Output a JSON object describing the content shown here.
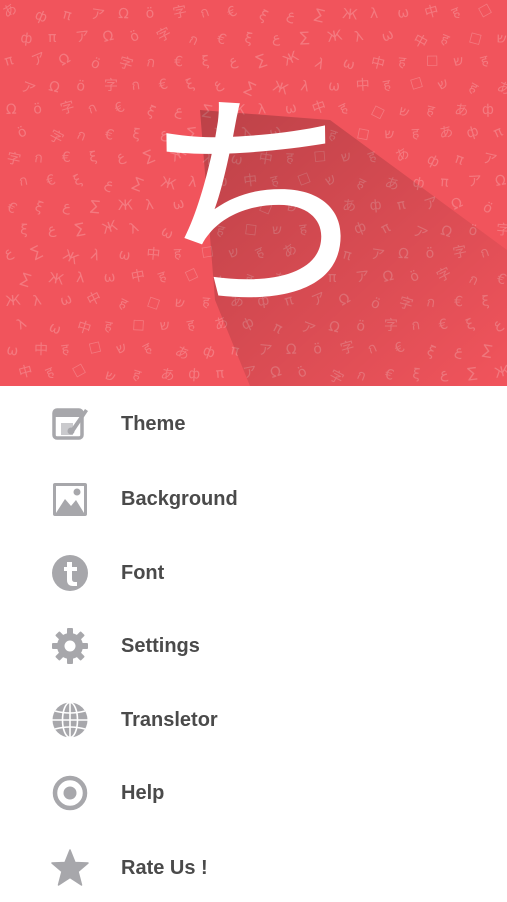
{
  "header": {
    "glyph": "ち",
    "background_color": "#f1545c",
    "glyph_color": "#ffffff",
    "pattern_glyphs": [
      "あ",
      "ア",
      "字",
      "ξ",
      "Ж",
      "中",
      "ש",
      "ф",
      "Ω",
      "ก",
      "ع",
      "λ",
      "ह",
      "ह",
      "π",
      "ö",
      "€",
      "∑",
      "ω",
      "☐"
    ]
  },
  "menu": {
    "icon_color": "#a7a7ab",
    "text_color": "#4a4a4a",
    "items": [
      {
        "icon": "theme-palette-icon",
        "label": "Theme"
      },
      {
        "icon": "image-icon",
        "label": "Background"
      },
      {
        "icon": "font-t-icon",
        "label": "Font"
      },
      {
        "icon": "gear-icon",
        "label": "Settings"
      },
      {
        "icon": "globe-icon",
        "label": "Transletor"
      },
      {
        "icon": "help-target-icon",
        "label": "Help"
      },
      {
        "icon": "star-icon",
        "label": "Rate Us !"
      }
    ]
  }
}
